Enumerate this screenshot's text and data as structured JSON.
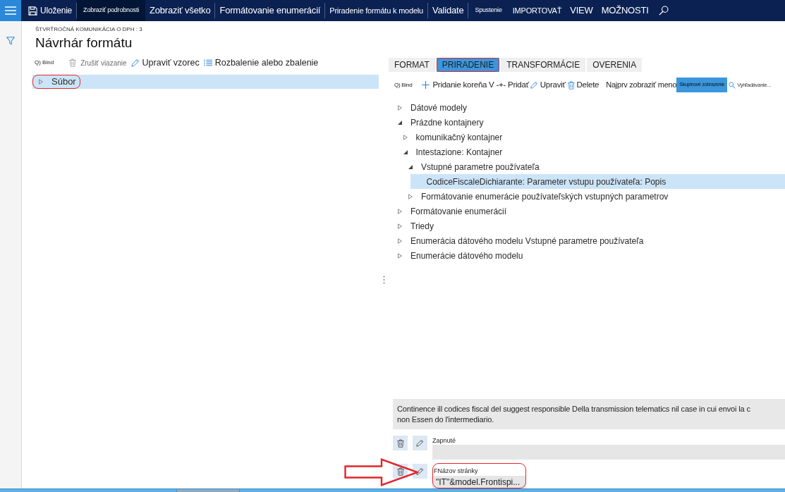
{
  "top_bar": {
    "groups": [
      [
        {
          "kind": "save",
          "label": "Uloženie",
          "pressed": false
        }
      ],
      [
        {
          "kind": "tiny",
          "label": "Zobraziť podrobnosti",
          "pressed": true
        },
        {
          "kind": "regular",
          "label": "Zobraziť všetko",
          "pressed": false
        }
      ],
      [
        {
          "kind": "regular",
          "label": "Formátovanie enumerácií",
          "pressed": false
        }
      ],
      [
        {
          "kind": "small",
          "label": "Priradenie formátu k modelu",
          "pressed": false
        }
      ],
      [
        {
          "kind": "regular",
          "label": "Validate",
          "pressed": false
        }
      ],
      [
        {
          "kind": "tiny",
          "label": "Spustenie",
          "pressed": false
        },
        {
          "kind": "small",
          "label": "IMPORTOVAŤ",
          "pressed": false
        },
        {
          "kind": "regular",
          "label": "VIEW",
          "pressed": false
        },
        {
          "kind": "regular",
          "label": "MOŽNOSTI",
          "pressed": false
        },
        {
          "kind": "search",
          "pressed": false
        }
      ]
    ]
  },
  "header": {
    "breadcrumb": "ŠTVRŤROČNÁ KOMUNIKÁCIA O DPH : 3",
    "title": "Návrhár formátu"
  },
  "left_pane": {
    "toolbar": [
      {
        "kind": "text",
        "label": "Q) Bind",
        "disabled": false
      },
      {
        "kind": "delete",
        "label": "Zrušiť viazanie",
        "disabled": true
      },
      {
        "kind": "edit",
        "label": "Upraviť vzorec",
        "disabled": false
      },
      {
        "kind": "list",
        "label": "Rozbalenie alebo zbalenie",
        "disabled": false
      }
    ],
    "tree": [
      {
        "kind": "branch",
        "label": "Súbor",
        "expanded": false,
        "selected": true,
        "callout": true
      }
    ]
  },
  "right_pane": {
    "tabs": [
      {
        "label": "FORMAT",
        "selected": false,
        "callout": false
      },
      {
        "label": "PRIRADENIE",
        "selected": true,
        "callout": true
      },
      {
        "label": "TRANSFORMÁCIE",
        "selected": false,
        "callout": false
      },
      {
        "label": "OVERENIA",
        "selected": false,
        "callout": false
      }
    ],
    "toolbar": [
      {
        "kind": "text",
        "label": "Q) Bind",
        "pressed": false
      },
      {
        "kind": "add",
        "label": "Pridanie koreňa V -+- Pridať",
        "pressed": false
      },
      {
        "kind": "edit",
        "label": "Upraviť",
        "pressed": false
      },
      {
        "kind": "delete",
        "label": "Delete",
        "pressed": false
      },
      {
        "kind": "plain",
        "label": "Najprv zobraziť meno",
        "pressed": false
      },
      {
        "kind": "toggle",
        "label": "Skupinové zobrazenie",
        "pressed": true
      }
    ],
    "search": {
      "placeholder": "Vyhľadávanie..."
    },
    "tree": [
      {
        "kind": "branch",
        "label": "Dátové modely",
        "expanded": false,
        "selected": false,
        "callout": false
      },
      {
        "kind": "branch",
        "label": "Prázdne kontajnery",
        "expanded": true,
        "selected": false,
        "callout": false,
        "children": [
          {
            "kind": "branch",
            "label": "komunikačný kontajner",
            "expanded": false,
            "selected": false,
            "callout": false
          },
          {
            "kind": "branch",
            "label": "Intestazione: Kontajner",
            "expanded": true,
            "selected": false,
            "callout": false,
            "children": [
              {
                "kind": "branch",
                "label": "Vstupné parametre používateľa",
                "expanded": true,
                "selected": false,
                "callout": false,
                "children": [
                  {
                    "kind": "leaf",
                    "label": "CodiceFiscaleDichiarante: Parameter vstupu používateľa: Popis",
                    "selected": true,
                    "callout": false
                  }
                ]
              },
              {
                "kind": "branch",
                "label": "Formátovanie enumerácie používateľských vstupných parametrov",
                "expanded": false,
                "selected": false,
                "callout": false
              }
            ]
          }
        ]
      },
      {
        "kind": "branch",
        "label": "Formátovanie enumerácií",
        "expanded": false,
        "selected": false,
        "callout": false
      },
      {
        "kind": "branch",
        "label": "Triedy",
        "expanded": false,
        "selected": false,
        "callout": false
      },
      {
        "kind": "branch",
        "label": "Enumerácia dátového modelu Vstupné parametre používateľa",
        "expanded": false,
        "selected": false,
        "callout": false
      },
      {
        "kind": "branch",
        "label": "Enumerácie dátového modelu",
        "expanded": false,
        "selected": false,
        "callout": false
      }
    ],
    "description": "Continence ill codices fiscal del suggest responsible Della transmission telematics nil case in cui envoi la c non Essen do l'intermediario.",
    "properties": [
      {
        "kind": "wide",
        "label": "Zapnuté",
        "callout": false,
        "arrow": false
      },
      {
        "kind": "compact",
        "label": "FNázov stránky",
        "value": "\"IT\"&model.Frontispi...",
        "callout": true,
        "arrow": true
      }
    ]
  }
}
